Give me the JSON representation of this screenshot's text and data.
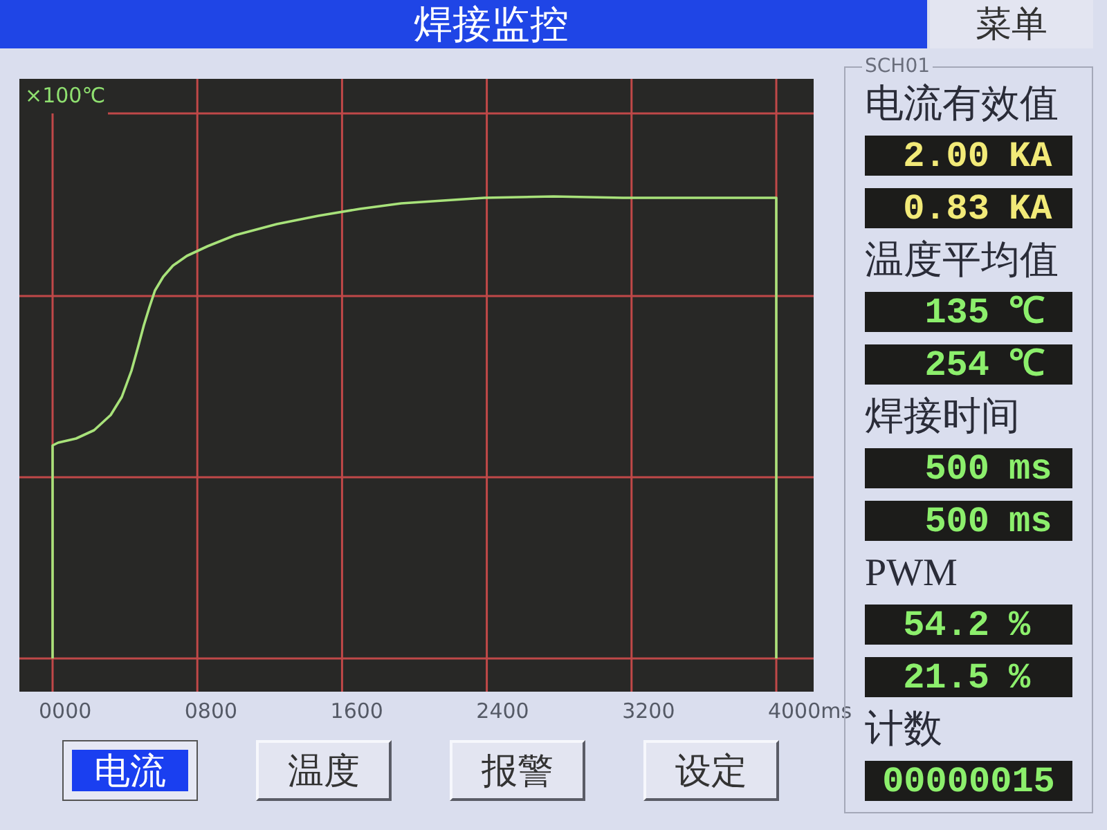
{
  "header": {
    "title": "焊接监控",
    "menu_button": "菜单"
  },
  "chart": {
    "unit_label": "×100℃",
    "x_tick_labels": [
      "0000",
      "0800",
      "1600",
      "2400",
      "3200",
      "4000ms"
    ]
  },
  "tabs": [
    {
      "label": "电流",
      "selected": true
    },
    {
      "label": "温度",
      "selected": false
    },
    {
      "label": "报警",
      "selected": false
    },
    {
      "label": "设定",
      "selected": false
    }
  ],
  "panel": {
    "legend": "SCH01",
    "groups": [
      {
        "label": "电流有效值",
        "color": "#f2ea78",
        "readings": [
          {
            "value": "2.00",
            "unit": "KA"
          },
          {
            "value": "0.83",
            "unit": "KA"
          }
        ]
      },
      {
        "label": "温度平均值",
        "color": "#8cef6c",
        "readings": [
          {
            "value": "135",
            "unit": "℃"
          },
          {
            "value": "254",
            "unit": "℃"
          }
        ]
      },
      {
        "label": "焊接时间",
        "color": "#8cef6c",
        "readings": [
          {
            "value": "500",
            "unit": "ms"
          },
          {
            "value": "500",
            "unit": "ms"
          }
        ]
      },
      {
        "label": "PWM",
        "color": "#8cef6c",
        "readings": [
          {
            "value": "54.2",
            "unit": "%"
          },
          {
            "value": "21.5",
            "unit": "%"
          }
        ]
      },
      {
        "label": "计数",
        "color": "#8cef6c",
        "readings": [
          {
            "value": "00000015"
          }
        ]
      }
    ]
  }
}
